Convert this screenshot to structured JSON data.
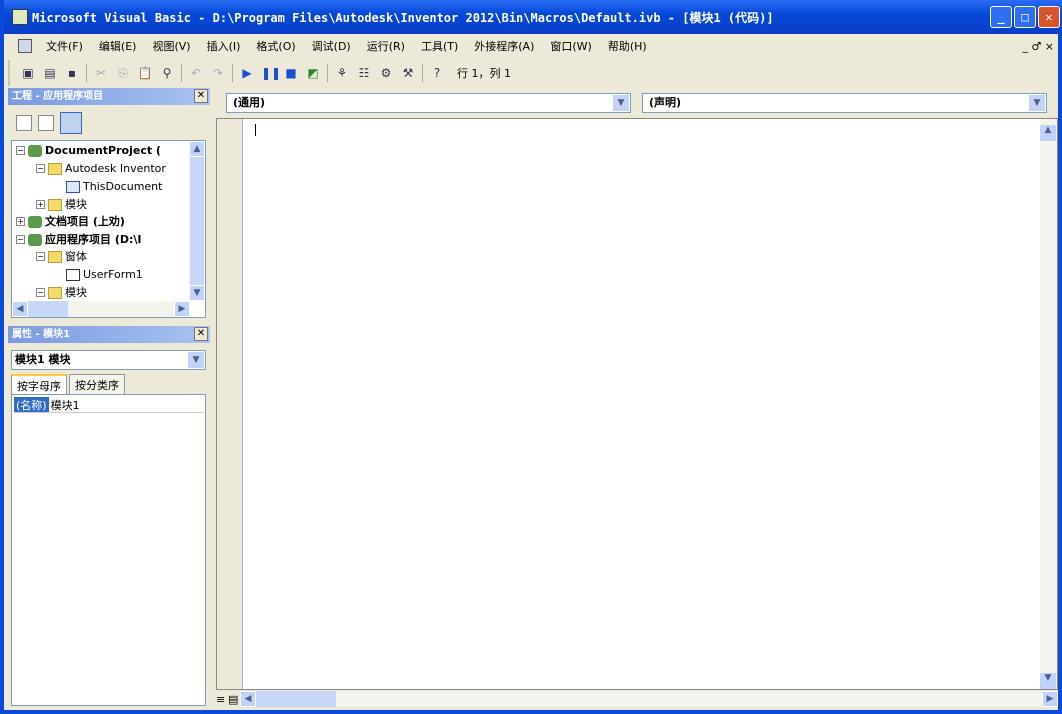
{
  "title": "Microsoft Visual Basic - D:\\Program Files\\Autodesk\\Inventor 2012\\Bin\\Macros\\Default.ivb - [模块1 (代码)]",
  "menu": [
    "文件(F)",
    "编辑(E)",
    "视图(V)",
    "插入(I)",
    "格式(O)",
    "调试(D)",
    "运行(R)",
    "工具(T)",
    "外接程序(A)",
    "窗口(W)",
    "帮助(H)"
  ],
  "mdi_controls": "_ ♂ ×",
  "toolbar": {
    "position": "行 1，列 1"
  },
  "project": {
    "title": "工程 - 应用程序项目",
    "tree": [
      "DocumentProject (",
      "Autodesk Inventor",
      "ThisDocument",
      "模块",
      "文档项目 (上劝)",
      "应用程序项目 (D:\\I",
      "窗体",
      "UserForm1",
      "模块"
    ]
  },
  "properties": {
    "title": "属性 - 模块1",
    "object": "模块1 模块",
    "tabs": [
      "按字母序",
      "按分类序"
    ],
    "rows": [
      {
        "key": "(名称)",
        "value": "模块1"
      }
    ]
  },
  "code": {
    "object": "(通用)",
    "procedure": "(声明)"
  }
}
